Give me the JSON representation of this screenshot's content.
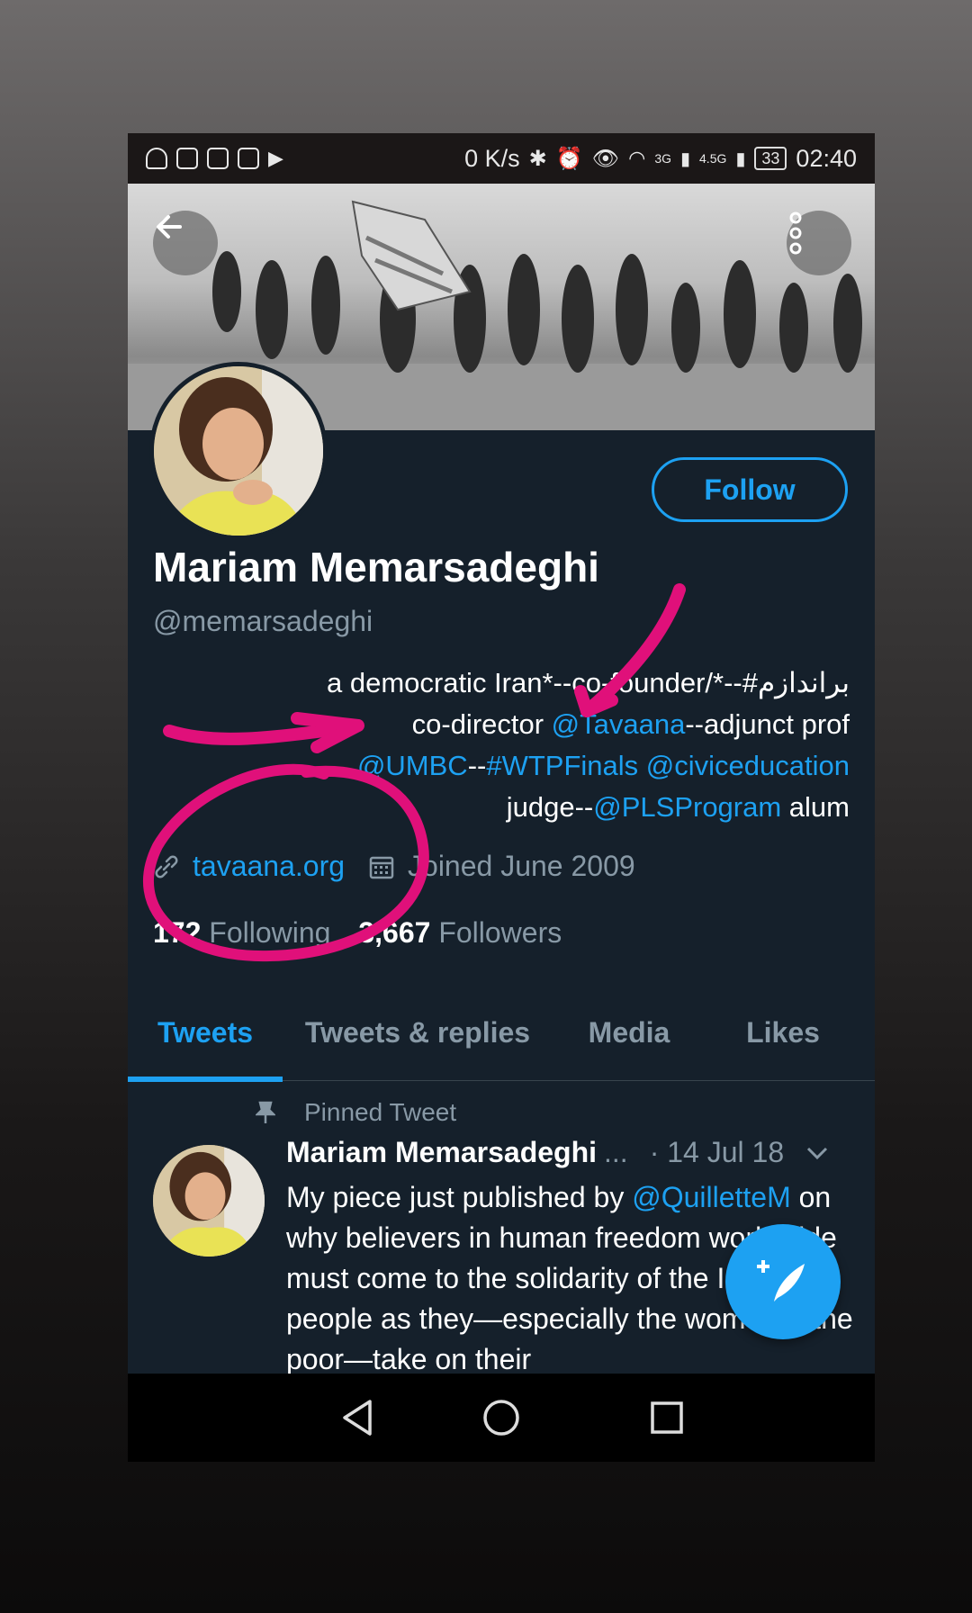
{
  "status_bar": {
    "speed": "0 K/s",
    "net_3g": "3G",
    "net_456": "4.5G",
    "battery": "33",
    "time": "02:40"
  },
  "profile": {
    "name": "Mariam Memarsadeghi",
    "handle": "@memarsadeghi",
    "follow_label": "Follow",
    "bio": {
      "line1": "a democratic Iran*--co-founder/*--#براندازم",
      "line2_text_a": "co-director ",
      "line2_link": "@Tavaana",
      "line2_text_b": "--adjunct prof",
      "line3_link_a": "@UMBC",
      "line3_sep": "--",
      "line3_link_b": "#WTPFinals",
      "line3_space": " ",
      "line3_link_c": "@civiceducation",
      "line4_text_a": "judge--",
      "line4_link": "@PLSProgram",
      "line4_text_b": " alum"
    },
    "website": "tavaana.org",
    "joined": "Joined June 2009",
    "following_count": "172",
    "following_label": " Following",
    "followers_count": "3,667",
    "followers_label": " Followers"
  },
  "tabs": [
    "Tweets",
    "Tweets & replies",
    "Media",
    "Likes"
  ],
  "active_tab": "Tweets",
  "pinned_tweet": {
    "pinned_label": "Pinned Tweet",
    "author": "Mariam Memarsadeghi",
    "ellipsis": "...",
    "date": "· 14 Jul 18",
    "text_a": "My piece just published by ",
    "text_link": "@QuilletteM",
    "text_b": " on why believers in human freedom worldwide must come to the solidarity of the Iranian people as they—especially the women & the poor—take on their"
  },
  "icons": {
    "back": "back-arrow-icon",
    "more": "more-vertical-icon",
    "link": "link-icon",
    "calendar": "calendar-icon",
    "pin": "pin-icon",
    "chevron": "chevron-down-icon",
    "compose": "compose-tweet-icon"
  },
  "colors": {
    "accent": "#1da1f2",
    "background": "#15202b",
    "secondary_text": "#8899a6",
    "annotation": "#e0107a"
  }
}
